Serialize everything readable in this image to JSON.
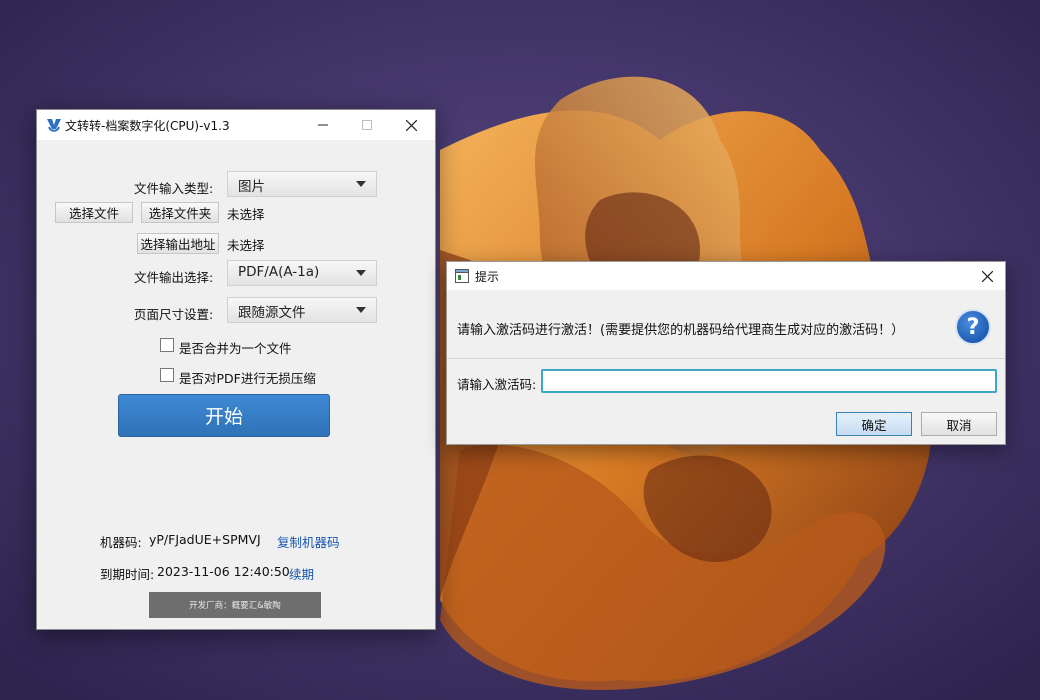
{
  "main_window": {
    "title": "文转转-档案数字化(CPU)-v1.3",
    "input_type_label": "文件输入类型:",
    "input_type_value": "图片",
    "choose_file_button": "选择文件",
    "choose_folder_button": "选择文件夹",
    "input_status": "未选择",
    "choose_output_button": "选择输出地址",
    "output_status": "未选择",
    "output_format_label": "文件输出选择:",
    "output_format_value": "PDF/A(A-1a)",
    "page_size_label": "页面尺寸设置:",
    "page_size_value": "跟随源文件",
    "merge_checkbox_label": "是否合并为一个文件",
    "merge_checked": false,
    "compress_checkbox_label": "是否对PDF进行无损压缩",
    "compress_checked": false,
    "start_button": "开始",
    "machine_code_label": "机器码:",
    "machine_code_value": "yP/FJadUE+SPMVJ",
    "copy_machine_code_link": "复制机器码",
    "expiry_label": "到期时间:",
    "expiry_value": "2023-11-06 12:40:50",
    "renew_link": "续期",
    "developer_text": "开发厂商：概要汇&敏陶"
  },
  "dialog": {
    "title": "提示",
    "message": "请输入激活码进行激活！(需要提供您的机器码给代理商生成对应的激活码！）",
    "code_label": "请输入激活码:",
    "code_value": "",
    "ok_button": "确定",
    "cancel_button": "取消"
  },
  "colors": {
    "accent": "#2f72b8",
    "link": "#1a56b0",
    "focus_border": "#3fa6c8",
    "wallpaper_bg": "#3a2a5a",
    "wallpaper_orange": "#e08a2c"
  },
  "icons": {
    "app": "app-logo-icon",
    "minimize": "minimize-icon",
    "maximize": "maximize-icon",
    "close": "close-icon",
    "dropdown": "chevron-down-icon",
    "help": "question-icon",
    "dialog_app": "window-icon"
  }
}
